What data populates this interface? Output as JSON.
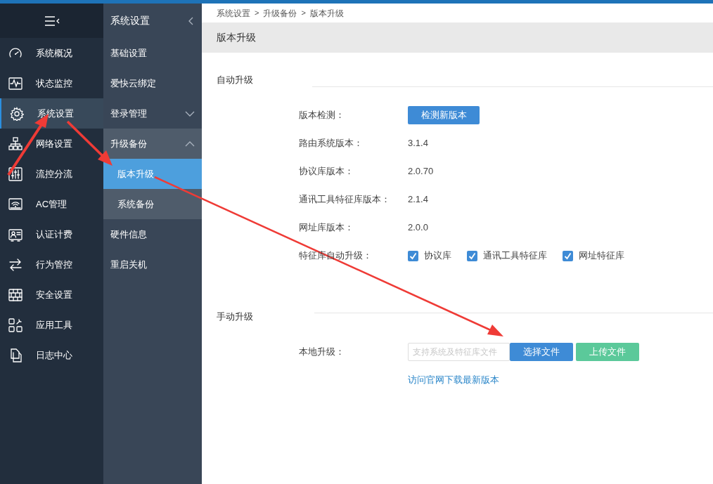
{
  "nav": {
    "items": [
      {
        "label": "系统概况",
        "selected": false
      },
      {
        "label": "状态监控",
        "selected": false
      },
      {
        "label": "系统设置",
        "selected": true
      },
      {
        "label": "网络设置",
        "selected": false
      },
      {
        "label": "流控分流",
        "selected": false
      },
      {
        "label": "AC管理",
        "selected": false
      },
      {
        "label": "认证计费",
        "selected": false
      },
      {
        "label": "行为管控",
        "selected": false
      },
      {
        "label": "安全设置",
        "selected": false
      },
      {
        "label": "应用工具",
        "selected": false
      },
      {
        "label": "日志中心",
        "selected": false
      }
    ]
  },
  "subnav": {
    "title": "系统设置",
    "items": [
      {
        "label": "基础设置",
        "kind": "item"
      },
      {
        "label": "爱快云绑定",
        "kind": "item"
      },
      {
        "label": "登录管理",
        "kind": "group",
        "expanded": false
      },
      {
        "label": "升级备份",
        "kind": "group",
        "expanded": true,
        "children": [
          {
            "label": "版本升级",
            "selected": true
          },
          {
            "label": "系统备份",
            "selected": false
          }
        ]
      },
      {
        "label": "硬件信息",
        "kind": "item"
      },
      {
        "label": "重启关机",
        "kind": "item"
      }
    ]
  },
  "breadcrumb": [
    "系统设置",
    "升级备份",
    "版本升级"
  ],
  "breadcrumb_separators": [
    ">",
    ">"
  ],
  "page_title": "版本升级",
  "auto_upgrade": {
    "title": "自动升级",
    "check_label": "版本检测：",
    "check_button": "检测新版本",
    "rows": [
      {
        "label": "路由系统版本：",
        "value": "3.1.4"
      },
      {
        "label": "协议库版本：",
        "value": "2.0.70"
      },
      {
        "label": "通讯工具特征库版本：",
        "value": "2.1.4"
      },
      {
        "label": "网址库版本：",
        "value": "2.0.0"
      }
    ],
    "auto_label": "特征库自动升级：",
    "options": [
      {
        "label": "协议库",
        "checked": true
      },
      {
        "label": "通讯工具特征库",
        "checked": true
      },
      {
        "label": "网址特征库",
        "checked": true
      }
    ]
  },
  "manual_upgrade": {
    "title": "手动升级",
    "label": "本地升级：",
    "file_field": {
      "placeholder": "支持系统及特征库文件"
    },
    "choose_button": "选择文件",
    "upload_button": "上传文件",
    "link": "访问官网下载最新版本"
  }
}
